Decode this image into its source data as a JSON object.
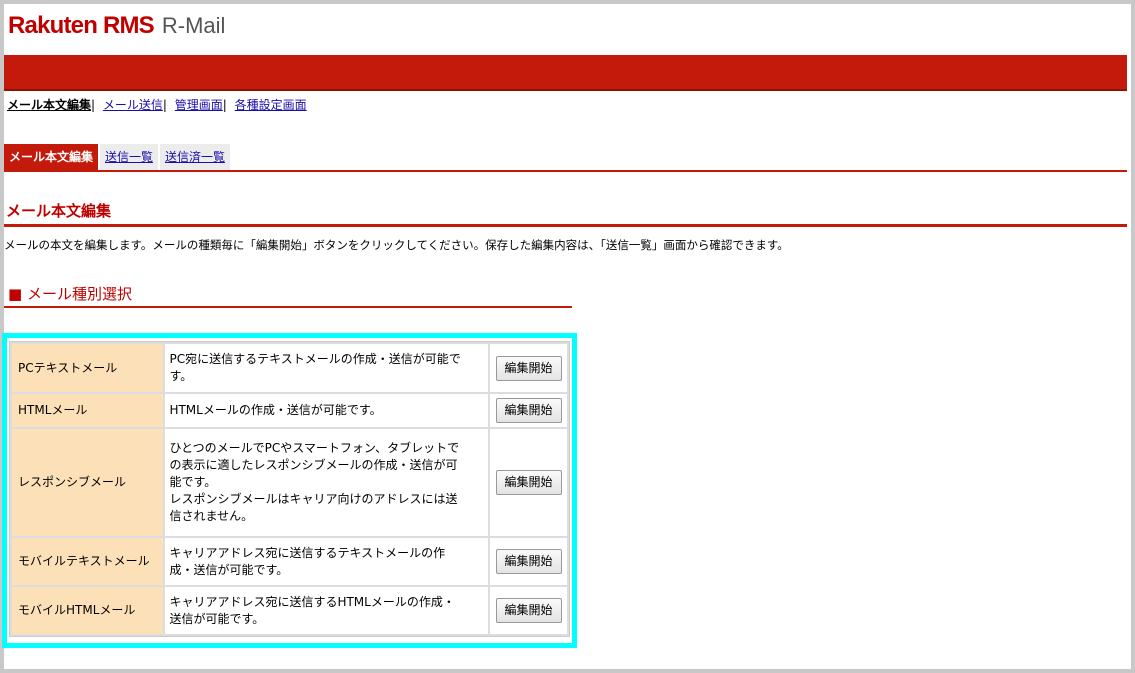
{
  "logo": {
    "brand": "Rakuten RMS",
    "product": "R-Mail"
  },
  "topnav": {
    "items": [
      "メール本文編集",
      "メール送信",
      "管理画面",
      "各種設定画面"
    ],
    "separator": "|"
  },
  "tabs": [
    "メール本文編集",
    "送信一覧",
    "送信済一覧"
  ],
  "section": {
    "title": "メール本文編集",
    "description": "メールの本文を編集します。メールの種類毎に「編集開始」ボタンをクリックしてください。保存した編集内容は、「送信一覧」画面から確認できます。"
  },
  "subsection": {
    "title": "■ メール種別選択"
  },
  "button_label": "編集開始",
  "mail_types": [
    {
      "name": "PCテキストメール",
      "lines": [
        "PC宛に送信するテキストメールの作成・送信が可能で",
        "す。"
      ]
    },
    {
      "name": "HTMLメール",
      "lines": [
        "HTMLメールの作成・送信が可能です。"
      ]
    },
    {
      "name": "レスポンシブメール",
      "lines": [
        "ひとつのメールでPCやスマートフォン、タブレットで",
        "の表示に適したレスポンシブメールの作成・送信が可",
        "能です。",
        "レスポンシブメールはキャリア向けのアドレスには送",
        "信されません。"
      ]
    },
    {
      "name": "モバイルテキストメール",
      "lines": [
        "キャリアアドレス宛に送信するテキストメールの作",
        "成・送信が可能です。"
      ]
    },
    {
      "name": "モバイルHTMLメール",
      "lines": [
        "キャリアアドレス宛に送信するHTMLメールの作成・",
        "送信が可能です。"
      ]
    }
  ],
  "colors": {
    "accent": "#c41a0b",
    "type_cell": "#fce0b8",
    "highlight": "#00ffff"
  }
}
